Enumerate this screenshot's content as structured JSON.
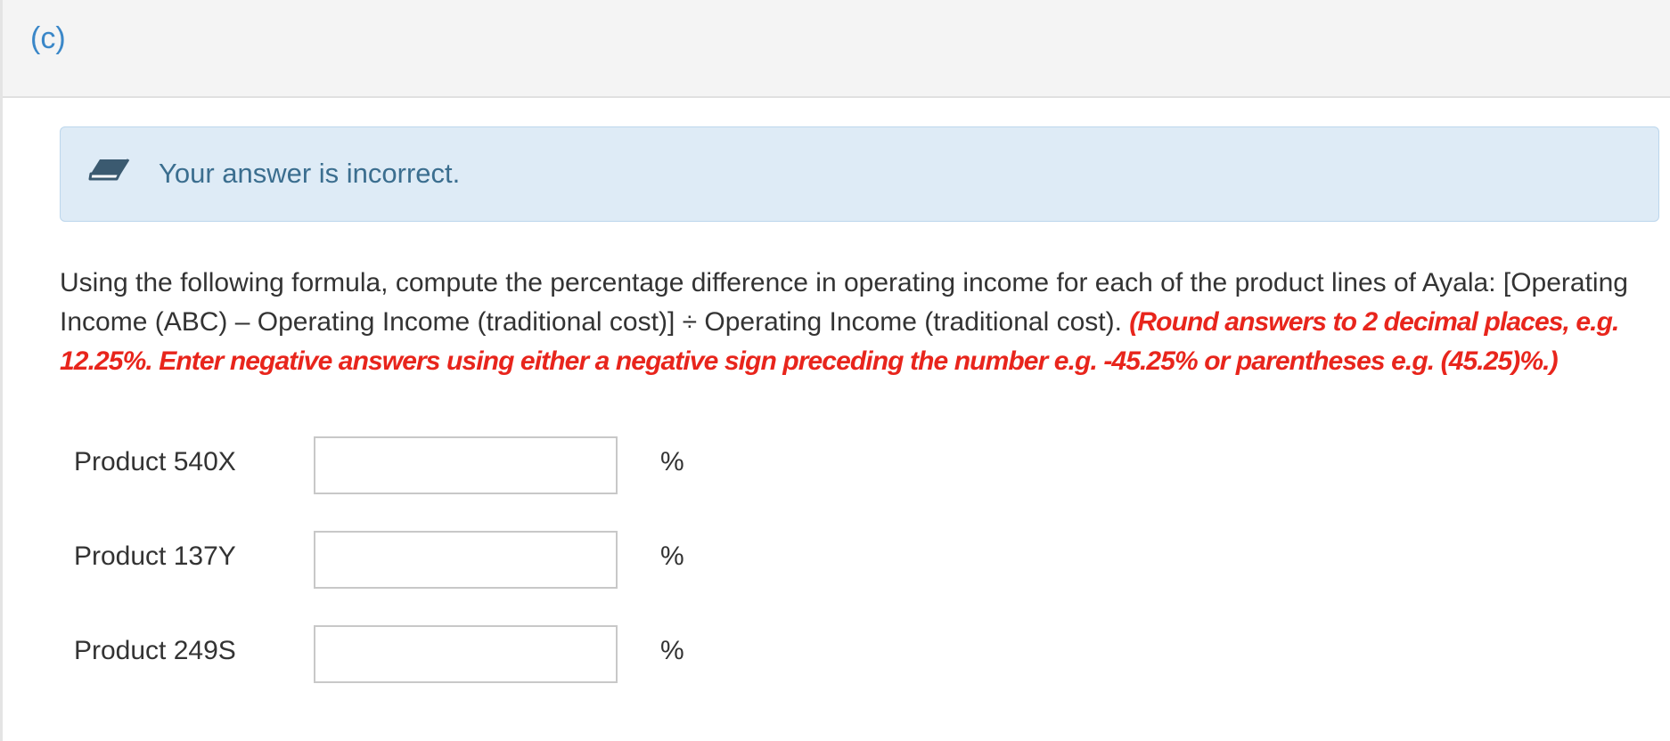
{
  "part": {
    "label": "(c)"
  },
  "feedback": {
    "icon": "eraser-icon",
    "message": "Your answer is incorrect."
  },
  "question": {
    "text": "Using the following formula, compute the percentage difference in operating income for each of the product lines of Ayala: [Operating Income (ABC) – Operating Income (traditional cost)] ÷ Operating Income (traditional cost). ",
    "instruction": "(Round answers to 2 decimal places, e.g. 12.25%. Enter negative answers using either a negative sign preceding the number e.g. -45.25% or parentheses e.g. (45.25)%.)"
  },
  "answers": [
    {
      "label": "Product 540X",
      "value": "",
      "unit": "%"
    },
    {
      "label": "Product 137Y",
      "value": "",
      "unit": "%"
    },
    {
      "label": "Product 249S",
      "value": "",
      "unit": "%"
    }
  ],
  "colors": {
    "accent": "#3a87c8",
    "feedback_bg": "#deebf6",
    "feedback_text": "#3b6e8f",
    "instruction": "#e8251c"
  }
}
